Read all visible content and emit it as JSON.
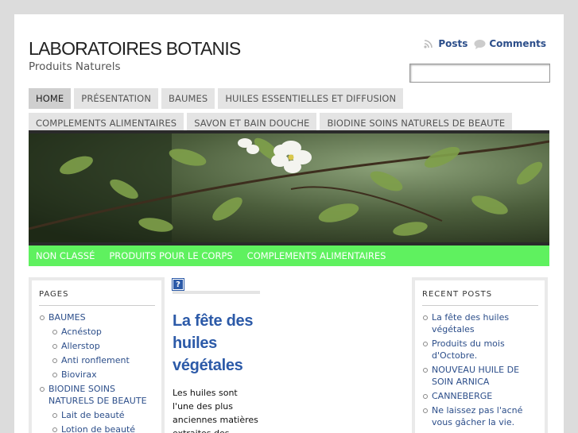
{
  "site": {
    "title": "LABORATOIRES BOTANIS",
    "description": "Produits Naturels"
  },
  "feeds": {
    "posts": "Posts",
    "comments": "Comments"
  },
  "search": {
    "value": ""
  },
  "nav": [
    {
      "label": "HOME"
    },
    {
      "label": "PRÉSENTATION"
    },
    {
      "label": "BAUMES"
    },
    {
      "label": "HUILES ESSENTIELLES ET DIFFUSION"
    },
    {
      "label": "COMPLEMENTS ALIMENTAIRES"
    },
    {
      "label": "SAVON ET BAIN DOUCHE"
    },
    {
      "label": "BIODINE SOINS NATURELS DE BEAUTE"
    }
  ],
  "categories": [
    {
      "label": "NON CLASSÉ"
    },
    {
      "label": "PRODUITS POUR LE CORPS"
    },
    {
      "label": "COMPLEMENTS ALIMENTAIRES"
    }
  ],
  "pages_widget": {
    "title": "PAGES",
    "items": [
      {
        "label": "BAUMES"
      },
      {
        "label": "Acnéstop"
      },
      {
        "label": "Allerstop"
      },
      {
        "label": "Anti ronflement"
      },
      {
        "label": "Biovirax"
      },
      {
        "label": "BIODINE SOINS NATURELS DE BEAUTE"
      },
      {
        "label": "Lait de beauté"
      },
      {
        "label": "Lotion de beauté"
      }
    ]
  },
  "post": {
    "icon_glyph": "?",
    "title": "La fête des huiles végétales",
    "excerpt": "Les huiles sont l'une des plus anciennes matières extraites des plantes, leurs"
  },
  "recent_widget": {
    "title": "RECENT POSTS",
    "items": [
      {
        "label": "La fête des huiles végétales"
      },
      {
        "label": "Produits du mois d'Octobre."
      },
      {
        "label": "NOUVEAU HUILE DE SOIN ARNICA"
      },
      {
        "label": "CANNEBERGE"
      },
      {
        "label": "Ne laissez pas l'acné vous gâcher la vie."
      }
    ]
  },
  "colors": {
    "accent": "#2c5aa8",
    "category_bar": "#5ff15f"
  },
  "icons": {
    "posts_feed": "rss-icon",
    "comments_feed": "comment-bubble-icon"
  }
}
